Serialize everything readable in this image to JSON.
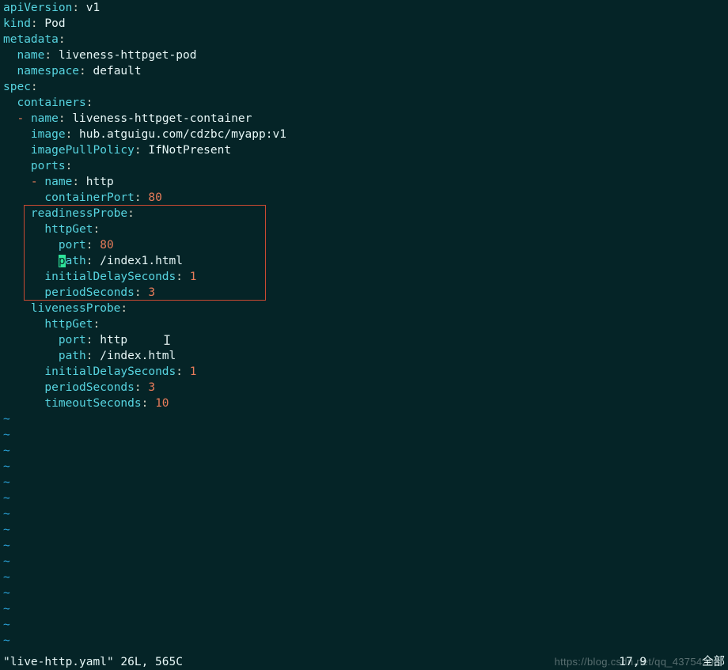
{
  "yaml": {
    "apiVersion": "v1",
    "kind": "Pod",
    "metadata": {
      "name": "liveness-httpget-pod",
      "namespace": "default"
    },
    "spec": {
      "containers": [
        {
          "name": "liveness-httpget-container",
          "image": "hub.atguigu.com/cdzbc/myapp:v1",
          "imagePullPolicy": "IfNotPresent",
          "ports": [
            {
              "name": "http",
              "containerPort": "80"
            }
          ],
          "readinessProbe": {
            "httpGet": {
              "port": "80",
              "path": "/index1.html"
            },
            "initialDelaySeconds": "1",
            "periodSeconds": "3"
          },
          "livenessProbe": {
            "httpGet": {
              "port": "http",
              "path": "/index.html"
            },
            "initialDelaySeconds": "1",
            "periodSeconds": "3",
            "timeoutSeconds": "10"
          }
        }
      ]
    }
  },
  "keys": {
    "apiVersion": "apiVersion",
    "kind": "kind",
    "metadata": "metadata",
    "name": "name",
    "namespace": "namespace",
    "spec": "spec",
    "containers": "containers",
    "image": "image",
    "imagePullPolicy": "imagePullPolicy",
    "ports": "ports",
    "containerPort": "containerPort",
    "readinessProbe": "readinessProbe",
    "httpGet": "httpGet",
    "port": "port",
    "path": "path",
    "initialDelaySeconds": "initialDelaySeconds",
    "periodSeconds": "periodSeconds",
    "livenessProbe": "livenessProbe",
    "timeoutSeconds": "timeoutSeconds"
  },
  "tilde": "~",
  "status": {
    "left": "\"live-http.yaml\" 26L, 565C",
    "right_pos": "17,9",
    "right_pct": "全部"
  },
  "watermark": "https://blog.csdn.net/qq_43754293"
}
